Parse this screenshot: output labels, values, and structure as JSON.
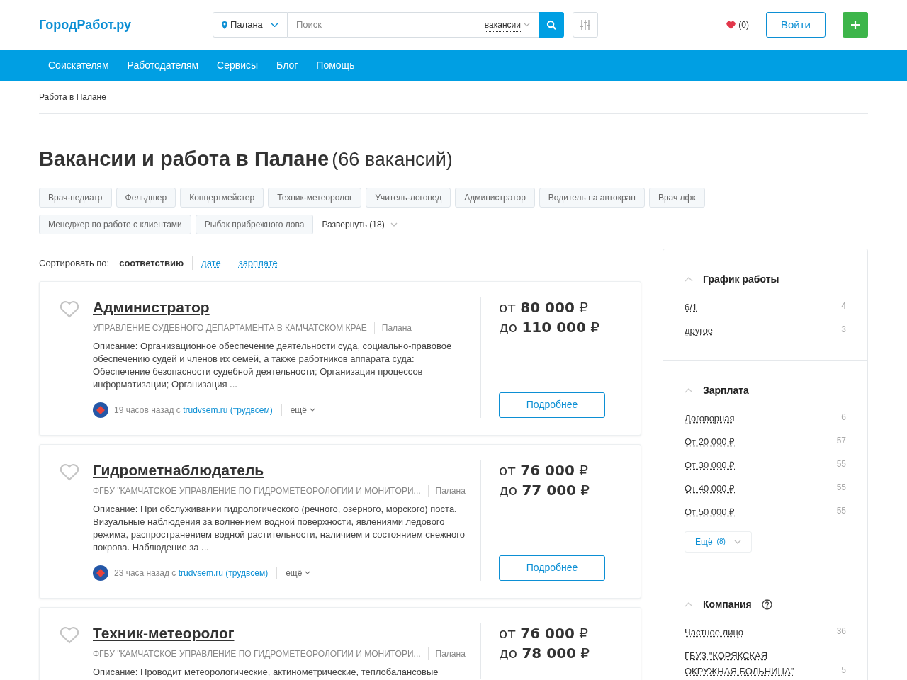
{
  "header": {
    "logo": "ГородРабот.ру",
    "location": "Палана",
    "search_placeholder": "Поиск",
    "search_scope": "вакансии",
    "favorites": "(0)",
    "login": "Войти"
  },
  "nav": [
    "Соискателям",
    "Работодателям",
    "Сервисы",
    "Блог",
    "Помощь"
  ],
  "breadcrumb": "Работа в Палане",
  "heading": {
    "title": "Вакансии и работа в Палане",
    "count": "(66 вакансий)"
  },
  "tags": [
    "Врач-педиатр",
    "Фельдшер",
    "Концертмейстер",
    "Техник-метеоролог",
    "Учитель-логопед",
    "Администратор",
    "Водитель на автокран",
    "Врач лфк",
    "Менеджер по работе с клиентами",
    "Рыбак прибрежного лова"
  ],
  "expand": "Развернуть (18)",
  "sort": {
    "label": "Сортировать по:",
    "options": [
      {
        "label": "соответствию",
        "selected": true
      },
      {
        "label": "дате",
        "selected": false
      },
      {
        "label": "зарплате",
        "selected": false
      }
    ]
  },
  "vacancies": [
    {
      "title": "Администратор",
      "company": "УПРАВЛЕНИЕ СУДЕБНОГО ДЕПАРТАМЕНТА В КАМЧАТСКОМ КРАЕ",
      "city": "Палана",
      "description": "Описание: Организационное обеспечение деятельности суда, социально-правовое обеспечению судей и членов их семей, а также работников аппарата суда: Обеспечение безопасности судебной деятельности; Организация процессов информатизации; Организация ...",
      "time": "19 часов назад с",
      "source": "trudvsem.ru (трудвсем)",
      "more": "ещё",
      "salary_from": "от **80 000** ₽",
      "salary_to": "до **110 000** ₽",
      "button": "Подробнее"
    },
    {
      "title": "Гидрометнаблюдатель",
      "company": "ФГБУ \"КАМЧАТСКОЕ УПРАВЛЕНИЕ ПО ГИДРОМЕТЕОРОЛОГИИ И МОНИТОРИ...",
      "city": "Палана",
      "description": "Описание: При обслуживании гидрологического (речного, озерного, морского) поста. Визуальные наблюдения за волнением водной поверхности, явлениями ледового режима, распространением водной растительности, наличием и состоянием снежного покрова. Наблюдение за ...",
      "time": "23 часа назад с",
      "source": "trudvsem.ru (трудвсем)",
      "more": "ещё",
      "salary_from": "от **76 000** ₽",
      "salary_to": "до **77 000** ₽",
      "button": "Подробнее"
    },
    {
      "title": "Техник-метеоролог",
      "company": "ФГБУ \"КАМЧАТСКОЕ УПРАВЛЕНИЕ ПО ГИДРОМЕТЕОРОЛОГИИ И МОНИТОРИ...",
      "city": "Палана",
      "description": "Описание: Проводит метеорологические, актинометрические, теплобалансовые",
      "salary_from": "от **76 000** ₽",
      "salary_to": "до **78 000** ₽"
    }
  ],
  "filters": [
    {
      "title": "График работы",
      "help": false,
      "items": [
        {
          "label": "6/1",
          "count": "4"
        },
        {
          "label": "другое",
          "count": "3"
        }
      ]
    },
    {
      "title": "Зарплата",
      "help": false,
      "items": [
        {
          "label": "Договорная",
          "count": "6"
        },
        {
          "label": "От 20 000 ₽",
          "count": "57"
        },
        {
          "label": "От 30 000 ₽",
          "count": "55"
        },
        {
          "label": "От 40 000 ₽",
          "count": "55"
        },
        {
          "label": "От 50 000 ₽",
          "count": "55"
        }
      ],
      "more": "Ещё",
      "more_count": "(8)"
    },
    {
      "title": "Компания",
      "help": true,
      "items": [
        {
          "label": "Частное лицо",
          "count": "36"
        },
        {
          "label": "ГБУЗ \"КОРЯКСКАЯ ОКРУЖНАЯ БОЛЬНИЦА\"",
          "count": "5"
        }
      ]
    }
  ]
}
